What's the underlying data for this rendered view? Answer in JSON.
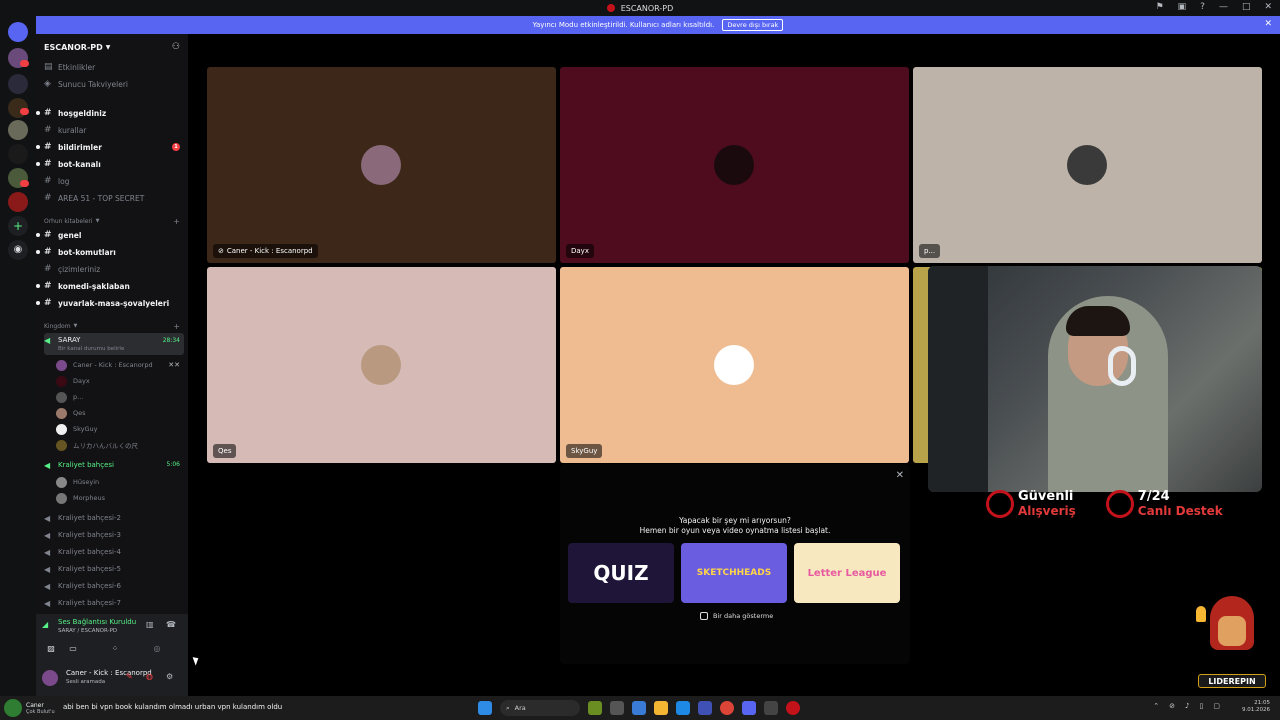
{
  "window": {
    "title": "ESCANOR-PD"
  },
  "banner": {
    "text": "Yayıncı Modu etkinleştirildi. Kullanıcı adları kısaltıldı.",
    "button": "Devre dışı bırak"
  },
  "server": {
    "name": "ESCANOR-PD"
  },
  "sidebar": {
    "top_items": [
      {
        "label": "Etkinlikler"
      },
      {
        "label": "Sunucu Takviyeleri"
      }
    ],
    "channels_a": [
      {
        "label": "hoşgeldiniz"
      },
      {
        "label": "kurallar"
      },
      {
        "label": "bildirimler",
        "badge": "1"
      },
      {
        "label": "bot-kanalı"
      },
      {
        "label": "log"
      },
      {
        "label": "AREA 51 - TOP SECRET"
      }
    ],
    "category_b": "Orhun kitabeleri",
    "channels_b": [
      {
        "label": "genel"
      },
      {
        "label": "bot-komutları"
      },
      {
        "label": "çizimleriniz"
      },
      {
        "label": "komedi-şaklaban"
      },
      {
        "label": "yuvarlak-masa-şovalyeleri"
      }
    ],
    "category_c": "Kingdom",
    "voice_active": {
      "label": "SARAY",
      "timer": "28:34",
      "status": "Bir kanal durumu belirle"
    },
    "voice_users": [
      {
        "name": "Caner - Kick : Escanorpd",
        "color": "#7a4a8a"
      },
      {
        "name": "Dayx",
        "color": "#3a0a14"
      },
      {
        "name": "p...",
        "color": "#555555"
      },
      {
        "name": "Qes",
        "color": "#9c7a6b"
      },
      {
        "name": "SkyGuy",
        "color": "#f0f0f0"
      },
      {
        "name": "ムリカハんバルくの尺",
        "color": "#665522"
      }
    ],
    "voice_garden": {
      "label": "Kraliyet bahçesi",
      "timer": "5:06"
    },
    "garden_users": [
      {
        "name": "Hüseyin",
        "color": "#888888"
      },
      {
        "name": "Morpheus",
        "color": "#777777"
      }
    ],
    "voice_more": [
      {
        "label": "Kraliyet bahçesi-2"
      },
      {
        "label": "Kraliyet bahçesi-3"
      },
      {
        "label": "Kraliyet bahçesi-4"
      },
      {
        "label": "Kraliyet bahçesi-5"
      },
      {
        "label": "Kraliyet bahçesi-6"
      },
      {
        "label": "Kraliyet bahçesi-7"
      }
    ]
  },
  "voice_panel": {
    "title": "Ses Bağlantısı Kuruldu",
    "sub": "SARAY / ESCANOR-PD"
  },
  "user_panel": {
    "name": "Caner - Kick : Escanorpd",
    "status": "Sesli aramada"
  },
  "tiles": [
    {
      "name": "Caner - Kick : Escanorpd",
      "bg": "#3c2718",
      "avatar": "#8a6a7a"
    },
    {
      "name": "Dayx",
      "bg": "#4e0c1e",
      "avatar": "#1a0a0e"
    },
    {
      "name": "p...",
      "bg": "#bdb3a8",
      "avatar": "#3a3a3a"
    },
    {
      "name": "Qes",
      "bg": "#d6bab6",
      "avatar": "#b99a80"
    },
    {
      "name": "SkyGuy",
      "bg": "#efbc92",
      "avatar": "#ffffff"
    }
  ],
  "activity": {
    "line1": "Yapacak bir şey mi arıyorsun?",
    "line2": "Hemen bir oyun veya video oynatma listesi başlat.",
    "games": [
      {
        "label": "QUIZ",
        "bg": "#1e1538",
        "fg": "#ffffff"
      },
      {
        "label": "SKETCHHEADS",
        "bg": "#6a5de0",
        "fg": "#ffd447"
      },
      {
        "label": "Letter League",
        "bg": "#f7e8c0",
        "fg": "#e85aa0"
      }
    ],
    "checkbox": "Bir daha gösterme"
  },
  "promo": {
    "item1_a": "Güvenli",
    "item1_b": "Alışveriş",
    "item2_a": "7/24",
    "item2_b": "Canlı Destek",
    "logo_text": "LIDEREPIN"
  },
  "taskbar": {
    "notif_name": "Caner",
    "notif_sub": "Çok Bulut'u",
    "notif_msg": "abi ben bi vpn book kulandım olmadı urban vpn kulandım oldu",
    "search": "Ara",
    "time": "21:05",
    "date": "9.01.2026"
  }
}
